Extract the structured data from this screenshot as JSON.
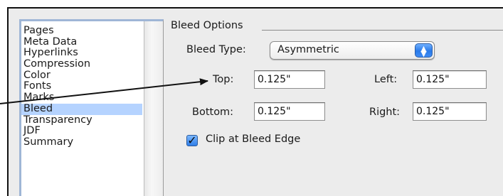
{
  "sidebar": {
    "items": [
      {
        "label": "Pages"
      },
      {
        "label": "Meta Data"
      },
      {
        "label": "Hyperlinks"
      },
      {
        "label": "Compression"
      },
      {
        "label": "Color"
      },
      {
        "label": "Fonts"
      },
      {
        "label": "Marks"
      },
      {
        "label": "Bleed",
        "selected": true
      },
      {
        "label": "Transparency"
      },
      {
        "label": "JDF"
      },
      {
        "label": "Summary"
      }
    ]
  },
  "bleed_options": {
    "group_title": "Bleed Options",
    "bleed_type": {
      "label": "Bleed Type:",
      "value": "Asymmetric",
      "control_icon": "up-down-arrows-icon"
    },
    "top": {
      "label": "Top:",
      "value": "0.125\""
    },
    "left": {
      "label": "Left:",
      "value": "0.125\""
    },
    "bottom": {
      "label": "Bottom:",
      "value": "0.125\""
    },
    "right": {
      "label": "Right:",
      "value": "0.125\""
    },
    "clip": {
      "label": "Clip at Bleed Edge",
      "checked": true
    }
  },
  "colors": {
    "selection": "#b5d3ff",
    "accent": "#2f7ee8"
  }
}
